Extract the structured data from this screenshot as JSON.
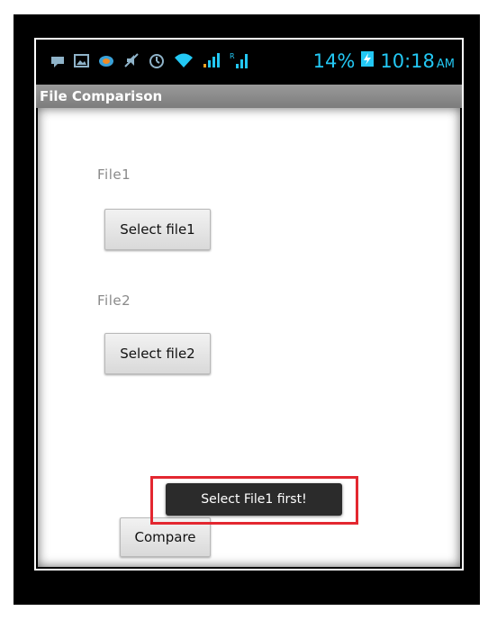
{
  "status_bar": {
    "battery_percent": "14%",
    "time": "10:18",
    "ampm": "AM",
    "icons": [
      "message-icon",
      "image-icon",
      "app-icon",
      "mute-icon",
      "alarm-icon",
      "wifi-icon",
      "signal-icon",
      "signal-r-icon",
      "battery-icon"
    ],
    "icon_color": "#23c8f4"
  },
  "app": {
    "title": "File Comparison"
  },
  "form": {
    "file1_label": "File1",
    "select_file1_label": "Select file1",
    "file2_label": "File2",
    "select_file2_label": "Select file2",
    "compare_label": "Compare"
  },
  "toast": {
    "message": "Select File1 first!",
    "highlight_color": "#e32730"
  }
}
